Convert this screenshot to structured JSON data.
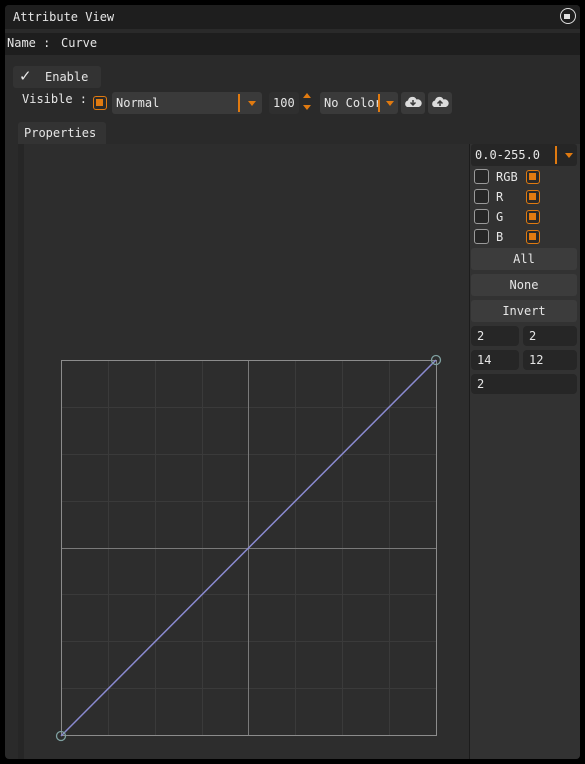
{
  "window": {
    "title": "Attribute View"
  },
  "name_row": {
    "label": "Name :",
    "value": "Curve"
  },
  "enable": {
    "label": "Enable",
    "checked": true
  },
  "visible": {
    "label": "Visible :",
    "blend_mode": "Normal",
    "opacity": "100",
    "color": "No Color"
  },
  "tabs": {
    "properties": "Properties"
  },
  "range_select": "0.0-255.0",
  "channels": [
    {
      "label": "RGB"
    },
    {
      "label": "R"
    },
    {
      "label": "G"
    },
    {
      "label": "B"
    }
  ],
  "buttons": {
    "all": "All",
    "none": "None",
    "invert": "Invert"
  },
  "fields": {
    "f1": "2",
    "f2": "2",
    "f3": "14",
    "f4": "12",
    "f5": "2"
  },
  "colors": {
    "accent": "#e07a10",
    "curve": "#8a8ad0"
  },
  "icons": [
    "close-window-icon",
    "checkmark-icon",
    "dropdown-arrow-icon",
    "spin-up-icon",
    "spin-down-icon",
    "cloud-download-icon",
    "cloud-upload-icon"
  ]
}
